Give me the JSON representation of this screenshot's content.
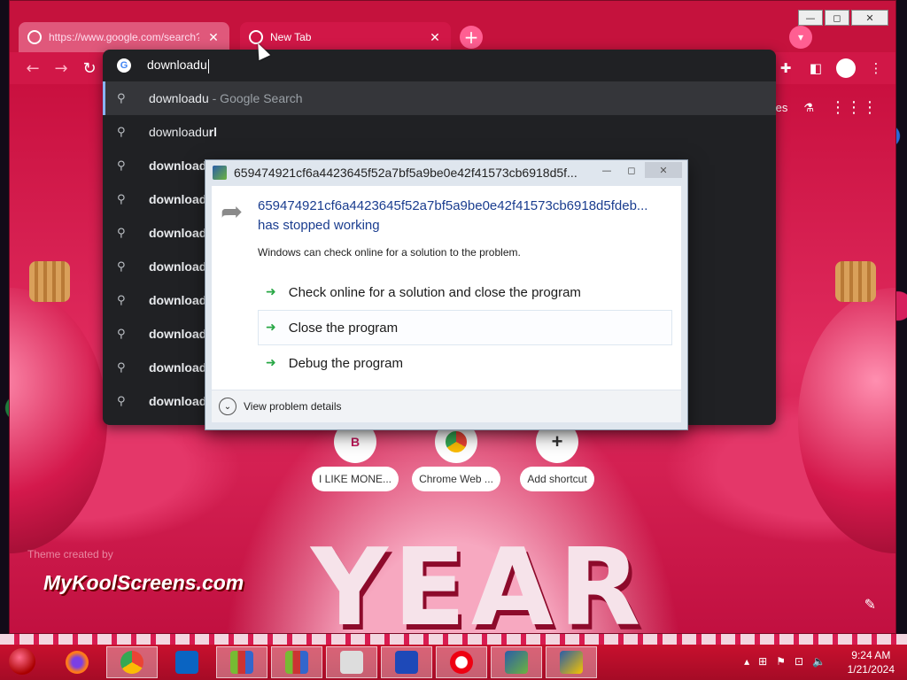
{
  "browser": {
    "tabs": [
      {
        "title": "https://www.google.com/search?",
        "active": false
      },
      {
        "title": "New Tab",
        "active": true
      }
    ],
    "new_tab_symbol": "+",
    "tab_close_symbol": "✕",
    "window_controls": {
      "minimize": "—",
      "maximize": "◻",
      "close": "✕"
    }
  },
  "omnibox": {
    "input_value": "downloadu",
    "suggestions": [
      {
        "bold": "",
        "text": "downloadu",
        "hint": " - Google Search",
        "selected": true
      },
      {
        "prefix": "downloadu",
        "bold": "rl",
        "hint": ""
      },
      {
        "text": "download"
      },
      {
        "text": "download"
      },
      {
        "text": "download"
      },
      {
        "text": "download"
      },
      {
        "text": "download"
      },
      {
        "text": "download"
      },
      {
        "text": "download"
      },
      {
        "text": "download"
      }
    ]
  },
  "page": {
    "images_link": "ges",
    "shortcuts": [
      {
        "icon_letter": "B",
        "label": "I LIKE MONE..."
      },
      {
        "icon_letter": "",
        "label": "Chrome Web ..."
      },
      {
        "icon_letter": "+",
        "label": "Add shortcut"
      }
    ],
    "theme_credit": "Theme created by",
    "watermark": "MyKoolScreens.com",
    "year_text": "YEAR"
  },
  "dialog": {
    "title": "659474921cf6a4423645f52a7bf5a9be0e42f41573cb6918d5f...",
    "heading_line1": "659474921cf6a4423645f52a7bf5a9be0e42f41573cb6918d5fdeb...",
    "heading_line2": "has stopped working",
    "info": "Windows can check online for a solution to the problem.",
    "options": [
      "Check online for a solution and close the program",
      "Close the program",
      "Debug the program"
    ],
    "footer": "View problem details"
  },
  "taskbar": {
    "clock_time": "9:24 AM",
    "clock_date": "1/21/2024"
  },
  "colors": {
    "browser_frame": "#c5123d",
    "omnibox_bg": "#202124",
    "dialog_link": "#1a3d8f"
  }
}
